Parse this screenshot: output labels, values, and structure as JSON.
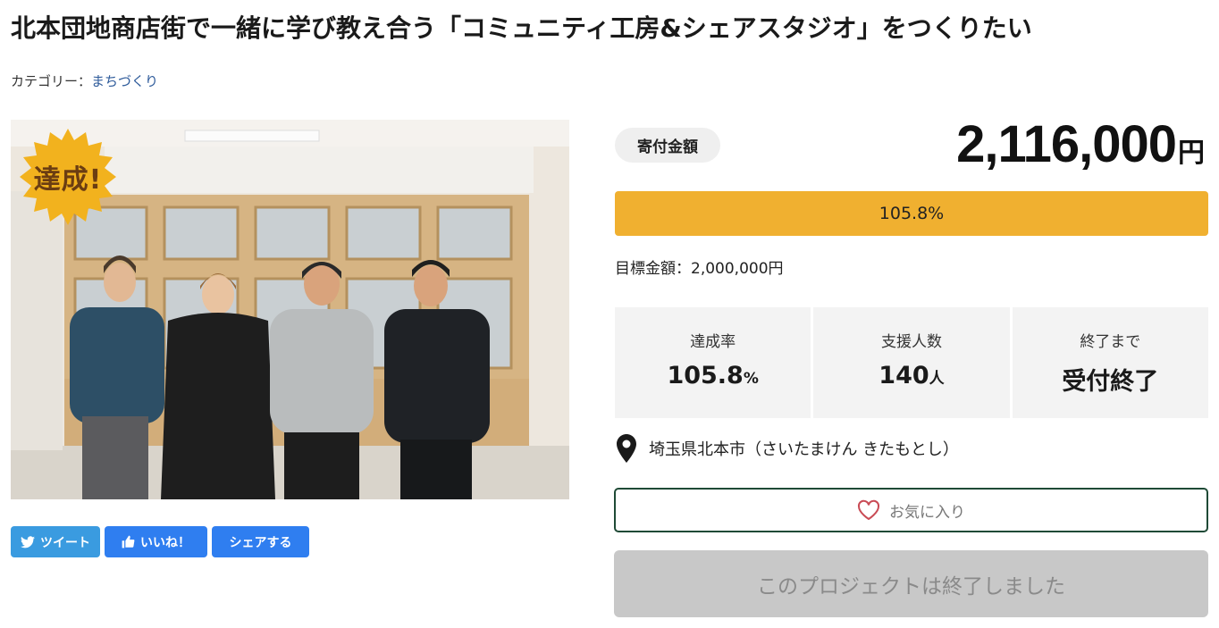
{
  "page": {
    "title": "北本団地商店街で一緒に学び教え合う「コミュニティ工房&シェアスタジオ」をつくりたい",
    "category_label": "カテゴリー：",
    "category_value": "まちづくり"
  },
  "photo": {
    "badge": "達成!"
  },
  "share": {
    "tweet": "ツイート",
    "like": "いいね！",
    "share": "シェアする"
  },
  "funding": {
    "amount_label": "寄付金額",
    "amount": "2,116,000",
    "amount_unit": "円",
    "progress_percent": 105.8,
    "progress_text": "105.8%",
    "goal_text": "目標金額：2,000,000円"
  },
  "stats": {
    "rate_label": "達成率",
    "rate_value": "105.8",
    "rate_unit": "%",
    "supporters_label": "支援人数",
    "supporters_value": "140",
    "supporters_unit": "人",
    "remaining_label": "終了まで",
    "remaining_value": "受付終了"
  },
  "location": {
    "text": "埼玉県北本市（さいたまけん きたもとし）"
  },
  "actions": {
    "favorite": "お気に入り",
    "ended": "このプロジェクトは終了しました"
  },
  "colors": {
    "progress": "#f0b030",
    "twitter": "#3a9be0",
    "facebook": "#2f7ef0",
    "favorite_border": "#1f4a36"
  }
}
